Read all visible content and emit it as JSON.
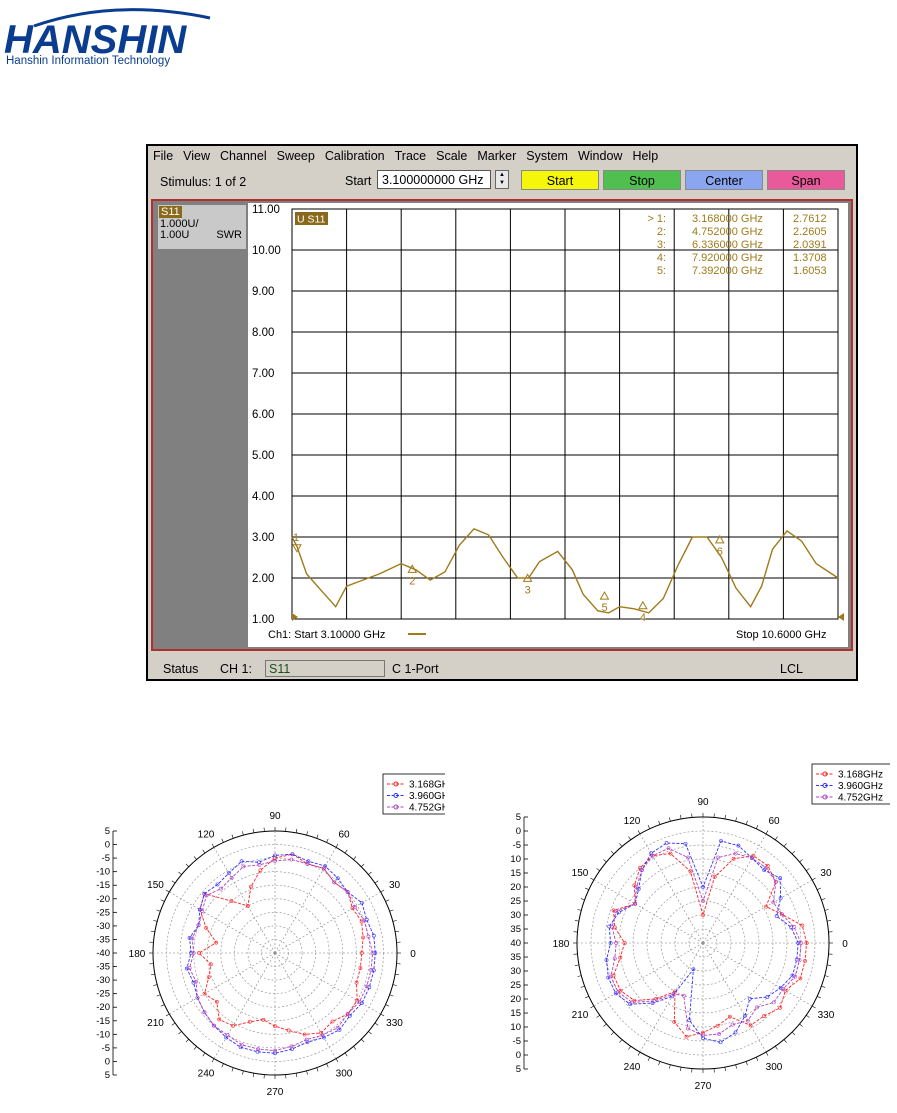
{
  "logo": {
    "company": "HANSHIN",
    "tagline": "Hanshin Information Technology"
  },
  "vna": {
    "menu": [
      "File",
      "View",
      "Channel",
      "Sweep",
      "Calibration",
      "Trace",
      "Scale",
      "Marker",
      "System",
      "Window",
      "Help"
    ],
    "stimulus_label": "Stimulus: 1 of 2",
    "start_label": "Start",
    "start_value": "3.100000000 GHz",
    "buttons": [
      {
        "label": "Start",
        "color": "#f6f60a"
      },
      {
        "label": "Stop",
        "color": "#4fc04f"
      },
      {
        "label": "Center",
        "color": "#8aa6f0"
      },
      {
        "label": "Span",
        "color": "#e85a9a"
      }
    ],
    "trace_panel": {
      "name": "S11",
      "scale": "1.000U/",
      "ref": "1.00U",
      "format": "SWR"
    },
    "trace_tag": "U S11",
    "channel_start": "Ch1: Start  3.10000 GHz",
    "stop": "Stop  10.6000 GHz",
    "markers": [
      {
        "label": "> 1:",
        "freq": "3.168000 GHz",
        "value": "2.7612"
      },
      {
        "label": "2:",
        "freq": "4.752000 GHz",
        "value": "2.2605"
      },
      {
        "label": "3:",
        "freq": "6.336000 GHz",
        "value": "2.0391"
      },
      {
        "label": "4:",
        "freq": "7.920000 GHz",
        "value": "1.3708"
      },
      {
        "label": "5:",
        "freq": "7.392000 GHz",
        "value": "1.6053"
      }
    ],
    "plot_markers": [
      {
        "label": "1",
        "x": 3.168,
        "y": 2.7612,
        "dir": "down"
      },
      {
        "label": "2",
        "x": 4.752,
        "y": 2.2605,
        "dir": "up"
      },
      {
        "label": "3",
        "x": 6.336,
        "y": 2.0391,
        "dir": "up"
      },
      {
        "label": "5",
        "x": 7.392,
        "y": 1.6053,
        "dir": "up"
      },
      {
        "label": "4",
        "x": 7.92,
        "y": 1.3708,
        "dir": "up"
      },
      {
        "label": "6",
        "x": 8.976,
        "y": 2.98,
        "dir": "up"
      }
    ],
    "status": {
      "status": "Status",
      "channel": "CH 1:",
      "field": "S11",
      "mode": "C  1-Port",
      "lcl": "LCL"
    },
    "colors": {
      "trace": "#a07a1a",
      "grid": "#000000",
      "frame": "#b03030"
    }
  },
  "chart_data": [
    {
      "type": "line",
      "title": "",
      "xlabel": "",
      "ylabel": "",
      "xlim": [
        3.1,
        10.6
      ],
      "ylim": [
        1.0,
        11.0
      ],
      "yticks": [
        "1.00",
        "2.00",
        "3.00",
        "4.00",
        "5.00",
        "6.00",
        "7.00",
        "8.00",
        "9.00",
        "10.00",
        "11.00"
      ],
      "series": [
        {
          "x": [
            3.1,
            3.17,
            3.3,
            3.5,
            3.7,
            3.85,
            4.0,
            4.3,
            4.6,
            4.8,
            5.0,
            5.2,
            5.4,
            5.6,
            5.8,
            6.0,
            6.2,
            6.35,
            6.5,
            6.75,
            6.95,
            7.1,
            7.3,
            7.45,
            7.6,
            7.8,
            8.0,
            8.2,
            8.4,
            8.6,
            8.8,
            9.0,
            9.2,
            9.4,
            9.55,
            9.7,
            9.9,
            10.1,
            10.3,
            10.6
          ],
          "y": [
            3.0,
            2.76,
            2.1,
            1.7,
            1.3,
            1.8,
            1.9,
            2.1,
            2.35,
            2.2,
            1.95,
            2.15,
            2.8,
            3.2,
            3.05,
            2.5,
            2.0,
            2.0,
            2.4,
            2.65,
            2.2,
            1.6,
            1.2,
            1.15,
            1.3,
            1.25,
            1.15,
            1.5,
            2.3,
            3.0,
            3.0,
            2.5,
            1.75,
            1.3,
            1.8,
            2.7,
            3.15,
            2.9,
            2.35,
            2.0
          ]
        }
      ]
    },
    {
      "type": "polar",
      "title": "",
      "rlabels": [
        "5",
        "0",
        "-5",
        "-10",
        "-15",
        "-20",
        "-25",
        "-30",
        "-35",
        "-40"
      ],
      "angles": [
        "0",
        "30",
        "60",
        "90",
        "120",
        "150",
        "180",
        "210",
        "240",
        "270",
        "300",
        "330"
      ],
      "legend": [
        "3.168GHz",
        "3.960GHz",
        "4.752GHz"
      ],
      "series": [
        {
          "name": "3.168GHz",
          "color": "#ff2020",
          "values": [
            -8,
            -7,
            -6,
            -7,
            -5,
            -6,
            -4,
            -5,
            -3,
            -5,
            -9,
            -14,
            -20,
            -15,
            -6,
            -8,
            -13,
            -18,
            -12,
            -16,
            -14,
            -10,
            -12,
            -8,
            -9,
            -13,
            -15,
            -13,
            -11,
            -8,
            -6,
            -7,
            -5,
            -5,
            -8,
            -8
          ]
        },
        {
          "name": "3.960GHz",
          "color": "#3030ff",
          "values": [
            -3,
            -3,
            -4,
            -3,
            -5,
            -4,
            -3,
            -4,
            -3,
            -4,
            -6,
            -4,
            -6,
            -7,
            -6,
            -8,
            -10,
            -8,
            -9,
            -7,
            -8,
            -7,
            -6,
            -5,
            -4,
            -3,
            -3,
            -3,
            -4,
            -5,
            -4,
            -3,
            -4,
            -3,
            -3,
            -3
          ]
        },
        {
          "name": "4.752GHz",
          "color": "#b040c0",
          "values": [
            -4,
            -5,
            -5,
            -6,
            -5,
            -6,
            -4,
            -5,
            -5,
            -6,
            -7,
            -6,
            -8,
            -9,
            -7,
            -9,
            -10,
            -9,
            -10,
            -8,
            -9,
            -7,
            -6,
            -5,
            -5,
            -4,
            -4,
            -4,
            -5,
            -6,
            -5,
            -4,
            -5,
            -4,
            -4,
            -4
          ]
        }
      ]
    },
    {
      "type": "polar",
      "title": "",
      "rlabels": [
        "5",
        "0",
        "-5",
        "-10",
        "-15",
        "-20",
        "-25",
        "-30",
        "-35",
        "-40"
      ],
      "angles": [
        "0",
        "30",
        "60",
        "90",
        "120",
        "150",
        "180",
        "210",
        "240",
        "270",
        "300",
        "330"
      ],
      "legend": [
        "3.168GHz",
        "3.960GHz",
        "4.752GHz"
      ],
      "series": [
        {
          "name": "3.168GHz",
          "color": "#ff2020",
          "values": [
            -3,
            -4,
            -10,
            -14,
            -6,
            -4,
            -4,
            -8,
            -16,
            -30,
            -14,
            -6,
            -4,
            -5,
            -8,
            -12,
            -6,
            -8,
            -12,
            -10,
            -6,
            -6,
            -8,
            -14,
            -20,
            -10,
            -6,
            -8,
            -10,
            -12,
            -6,
            -6,
            -4,
            -6,
            -3,
            -3
          ]
        },
        {
          "name": "3.960GHz",
          "color": "#3030ff",
          "values": [
            -6,
            -8,
            -12,
            -8,
            -4,
            -6,
            -5,
            -3,
            -3,
            -20,
            -4,
            -2,
            -3,
            -6,
            -10,
            -12,
            -8,
            -6,
            -7,
            -5,
            -4,
            -4,
            -6,
            -12,
            -18,
            -30,
            -12,
            -6,
            -4,
            -6,
            -10,
            -14,
            -10,
            -8,
            -6,
            -6
          ]
        },
        {
          "name": "4.752GHz",
          "color": "#b040c0",
          "values": [
            -5,
            -7,
            -10,
            -11,
            -6,
            -5,
            -5,
            -6,
            -9,
            -25,
            -9,
            -4,
            -4,
            -6,
            -9,
            -12,
            -7,
            -7,
            -9,
            -8,
            -5,
            -5,
            -7,
            -13,
            -19,
            -20,
            -9,
            -7,
            -7,
            -9,
            -8,
            -10,
            -7,
            -7,
            -5,
            -5
          ]
        }
      ]
    }
  ]
}
